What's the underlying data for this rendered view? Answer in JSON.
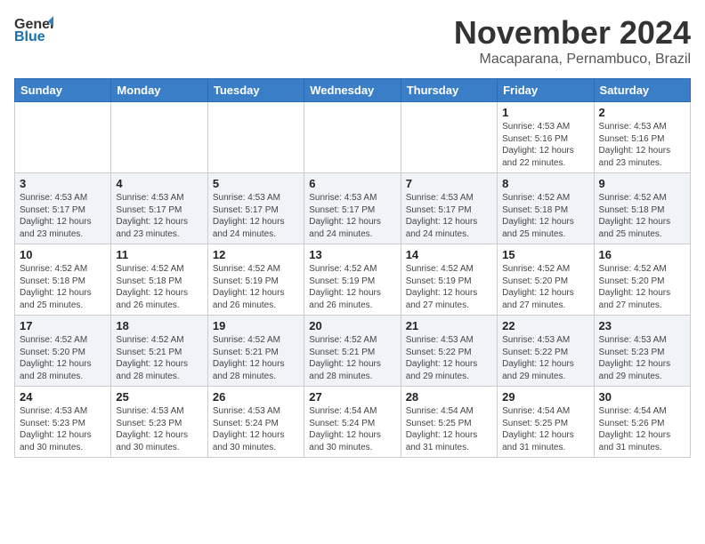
{
  "header": {
    "logo_general": "General",
    "logo_blue": "Blue",
    "month": "November 2024",
    "location": "Macaparana, Pernambuco, Brazil"
  },
  "weekdays": [
    "Sunday",
    "Monday",
    "Tuesday",
    "Wednesday",
    "Thursday",
    "Friday",
    "Saturday"
  ],
  "weeks": [
    [
      {
        "day": "",
        "info": ""
      },
      {
        "day": "",
        "info": ""
      },
      {
        "day": "",
        "info": ""
      },
      {
        "day": "",
        "info": ""
      },
      {
        "day": "",
        "info": ""
      },
      {
        "day": "1",
        "info": "Sunrise: 4:53 AM\nSunset: 5:16 PM\nDaylight: 12 hours and 22 minutes."
      },
      {
        "day": "2",
        "info": "Sunrise: 4:53 AM\nSunset: 5:16 PM\nDaylight: 12 hours and 23 minutes."
      }
    ],
    [
      {
        "day": "3",
        "info": "Sunrise: 4:53 AM\nSunset: 5:17 PM\nDaylight: 12 hours and 23 minutes."
      },
      {
        "day": "4",
        "info": "Sunrise: 4:53 AM\nSunset: 5:17 PM\nDaylight: 12 hours and 23 minutes."
      },
      {
        "day": "5",
        "info": "Sunrise: 4:53 AM\nSunset: 5:17 PM\nDaylight: 12 hours and 24 minutes."
      },
      {
        "day": "6",
        "info": "Sunrise: 4:53 AM\nSunset: 5:17 PM\nDaylight: 12 hours and 24 minutes."
      },
      {
        "day": "7",
        "info": "Sunrise: 4:53 AM\nSunset: 5:17 PM\nDaylight: 12 hours and 24 minutes."
      },
      {
        "day": "8",
        "info": "Sunrise: 4:52 AM\nSunset: 5:18 PM\nDaylight: 12 hours and 25 minutes."
      },
      {
        "day": "9",
        "info": "Sunrise: 4:52 AM\nSunset: 5:18 PM\nDaylight: 12 hours and 25 minutes."
      }
    ],
    [
      {
        "day": "10",
        "info": "Sunrise: 4:52 AM\nSunset: 5:18 PM\nDaylight: 12 hours and 25 minutes."
      },
      {
        "day": "11",
        "info": "Sunrise: 4:52 AM\nSunset: 5:18 PM\nDaylight: 12 hours and 26 minutes."
      },
      {
        "day": "12",
        "info": "Sunrise: 4:52 AM\nSunset: 5:19 PM\nDaylight: 12 hours and 26 minutes."
      },
      {
        "day": "13",
        "info": "Sunrise: 4:52 AM\nSunset: 5:19 PM\nDaylight: 12 hours and 26 minutes."
      },
      {
        "day": "14",
        "info": "Sunrise: 4:52 AM\nSunset: 5:19 PM\nDaylight: 12 hours and 27 minutes."
      },
      {
        "day": "15",
        "info": "Sunrise: 4:52 AM\nSunset: 5:20 PM\nDaylight: 12 hours and 27 minutes."
      },
      {
        "day": "16",
        "info": "Sunrise: 4:52 AM\nSunset: 5:20 PM\nDaylight: 12 hours and 27 minutes."
      }
    ],
    [
      {
        "day": "17",
        "info": "Sunrise: 4:52 AM\nSunset: 5:20 PM\nDaylight: 12 hours and 28 minutes."
      },
      {
        "day": "18",
        "info": "Sunrise: 4:52 AM\nSunset: 5:21 PM\nDaylight: 12 hours and 28 minutes."
      },
      {
        "day": "19",
        "info": "Sunrise: 4:52 AM\nSunset: 5:21 PM\nDaylight: 12 hours and 28 minutes."
      },
      {
        "day": "20",
        "info": "Sunrise: 4:52 AM\nSunset: 5:21 PM\nDaylight: 12 hours and 28 minutes."
      },
      {
        "day": "21",
        "info": "Sunrise: 4:53 AM\nSunset: 5:22 PM\nDaylight: 12 hours and 29 minutes."
      },
      {
        "day": "22",
        "info": "Sunrise: 4:53 AM\nSunset: 5:22 PM\nDaylight: 12 hours and 29 minutes."
      },
      {
        "day": "23",
        "info": "Sunrise: 4:53 AM\nSunset: 5:23 PM\nDaylight: 12 hours and 29 minutes."
      }
    ],
    [
      {
        "day": "24",
        "info": "Sunrise: 4:53 AM\nSunset: 5:23 PM\nDaylight: 12 hours and 30 minutes."
      },
      {
        "day": "25",
        "info": "Sunrise: 4:53 AM\nSunset: 5:23 PM\nDaylight: 12 hours and 30 minutes."
      },
      {
        "day": "26",
        "info": "Sunrise: 4:53 AM\nSunset: 5:24 PM\nDaylight: 12 hours and 30 minutes."
      },
      {
        "day": "27",
        "info": "Sunrise: 4:54 AM\nSunset: 5:24 PM\nDaylight: 12 hours and 30 minutes."
      },
      {
        "day": "28",
        "info": "Sunrise: 4:54 AM\nSunset: 5:25 PM\nDaylight: 12 hours and 31 minutes."
      },
      {
        "day": "29",
        "info": "Sunrise: 4:54 AM\nSunset: 5:25 PM\nDaylight: 12 hours and 31 minutes."
      },
      {
        "day": "30",
        "info": "Sunrise: 4:54 AM\nSunset: 5:26 PM\nDaylight: 12 hours and 31 minutes."
      }
    ]
  ]
}
